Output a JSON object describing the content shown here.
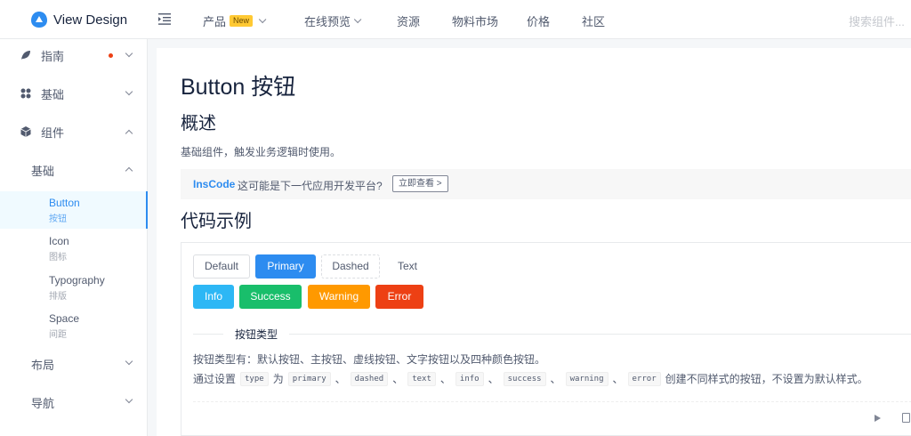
{
  "header": {
    "logo_text": "View Design",
    "nav": [
      {
        "label": "产品",
        "badge": "New",
        "has_dropdown": true
      },
      {
        "label": "在线预览",
        "has_dropdown": true
      },
      {
        "label": "资源"
      },
      {
        "label": "物料市场"
      },
      {
        "label": "价格"
      },
      {
        "label": "社区"
      }
    ],
    "search_placeholder": "搜索组件..."
  },
  "sidebar": {
    "groups": [
      {
        "label": "指南",
        "icon": "leaf-icon",
        "dot": true,
        "expanded": false
      },
      {
        "label": "基础",
        "icon": "grid-icon",
        "expanded": false
      },
      {
        "label": "组件",
        "icon": "cube-icon",
        "expanded": true
      }
    ],
    "sub_group": {
      "label": "基础",
      "expanded": true
    },
    "leaves": [
      {
        "en": "Button",
        "zh": "按钮",
        "active": true
      },
      {
        "en": "Icon",
        "zh": "图标"
      },
      {
        "en": "Typography",
        "zh": "排版"
      },
      {
        "en": "Space",
        "zh": "间距"
      }
    ],
    "more_groups": [
      {
        "label": "布局"
      },
      {
        "label": "导航"
      }
    ]
  },
  "main": {
    "title": "Button 按钮",
    "overview_heading": "概述",
    "overview_text": "基础组件，触发业务逻辑时使用。",
    "promo": {
      "brand": "InsCode",
      "text": "这可能是下一代应用开发平台?",
      "button": "立即查看 >"
    },
    "examples_heading": "代码示例",
    "demo": {
      "buttons_row1": [
        "Default",
        "Primary",
        "Dashed",
        "Text"
      ],
      "buttons_row2": [
        "Info",
        "Success",
        "Warning",
        "Error"
      ],
      "section_title": "按钮类型",
      "desc1": "按钮类型有：默认按钮、主按钮、虚线按钮、文字按钮以及四种颜色按钮。",
      "desc2_prefix": "通过设置",
      "desc2_attr": "type",
      "desc2_mid": "为",
      "desc2_values": [
        "primary",
        "dashed",
        "text",
        "info",
        "success",
        "warning",
        "error"
      ],
      "desc2_sep": "、",
      "desc2_suffix": "创建不同样式的按钮，不设置为默认样式。"
    }
  },
  "colors": {
    "primary": "#2d8cf0",
    "info": "#2db7f5",
    "success": "#19be6b",
    "warning": "#ff9900",
    "error": "#ed4014"
  }
}
